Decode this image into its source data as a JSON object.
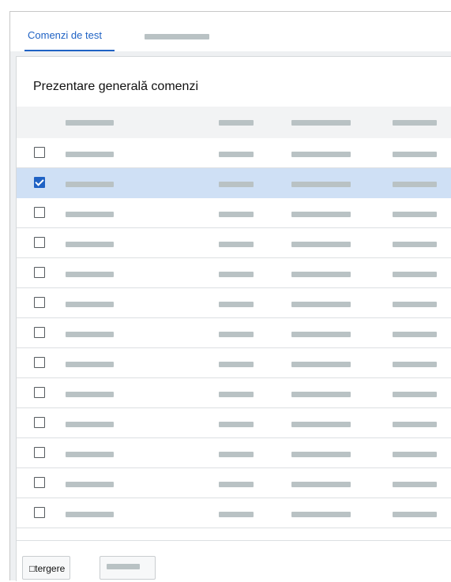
{
  "tabs": [
    {
      "label": "Comenzi de test",
      "active": true
    },
    {
      "label": "",
      "active": false
    }
  ],
  "panel": {
    "title": "Prezentare generală comenzi"
  },
  "table": {
    "columns": [
      "",
      "",
      "",
      ""
    ],
    "rows": [
      {
        "checked": false
      },
      {
        "checked": true
      },
      {
        "checked": false
      },
      {
        "checked": false
      },
      {
        "checked": false
      },
      {
        "checked": false
      },
      {
        "checked": false
      },
      {
        "checked": false
      },
      {
        "checked": false
      },
      {
        "checked": false
      },
      {
        "checked": false
      },
      {
        "checked": false
      },
      {
        "checked": false
      }
    ]
  },
  "footer": {
    "delete_label": "□tergere",
    "other_label": ""
  },
  "colors": {
    "accent": "#1f62c4",
    "selected_row": "#cfe0f5",
    "placeholder": "#b9c2c4"
  }
}
